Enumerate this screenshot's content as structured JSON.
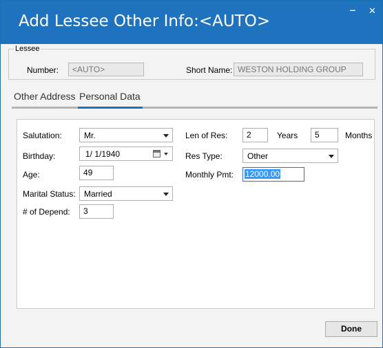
{
  "window": {
    "title": "Add Lessee Other Info:<AUTO>",
    "minimize_glyph": "‒",
    "close_glyph": "✕"
  },
  "lessee": {
    "legend": "Lessee",
    "number_label": "Number:",
    "number_value": "<AUTO>",
    "short_name_label": "Short Name:",
    "short_name_value": "WESTON HOLDING GROUP"
  },
  "tabs": [
    {
      "label": "Other Address",
      "active": false
    },
    {
      "label": "Personal Data",
      "active": true
    }
  ],
  "personal": {
    "salutation_label": "Salutation:",
    "salutation_value": "Mr.",
    "birthday_label": "Birthday:",
    "birthday_value": "1/  1/1940",
    "age_label": "Age:",
    "age_value": "49",
    "marital_label": "Marital Status:",
    "marital_value": "Married",
    "depend_label": "# of Depend:",
    "depend_value": "3",
    "len_res_label": "Len of Res:",
    "len_res_years_value": "2",
    "years_label": "Years",
    "len_res_months_value": "5",
    "months_label": "Months",
    "res_type_label": "Res Type:",
    "res_type_value": "Other",
    "monthly_pmt_label": "Monthly Pmt:",
    "monthly_pmt_value": "12000.00"
  },
  "buttons": {
    "done": "Done"
  },
  "colors": {
    "titlebar": "#1f72bd",
    "accent": "#1f72bd",
    "selection": "#3399ff"
  }
}
